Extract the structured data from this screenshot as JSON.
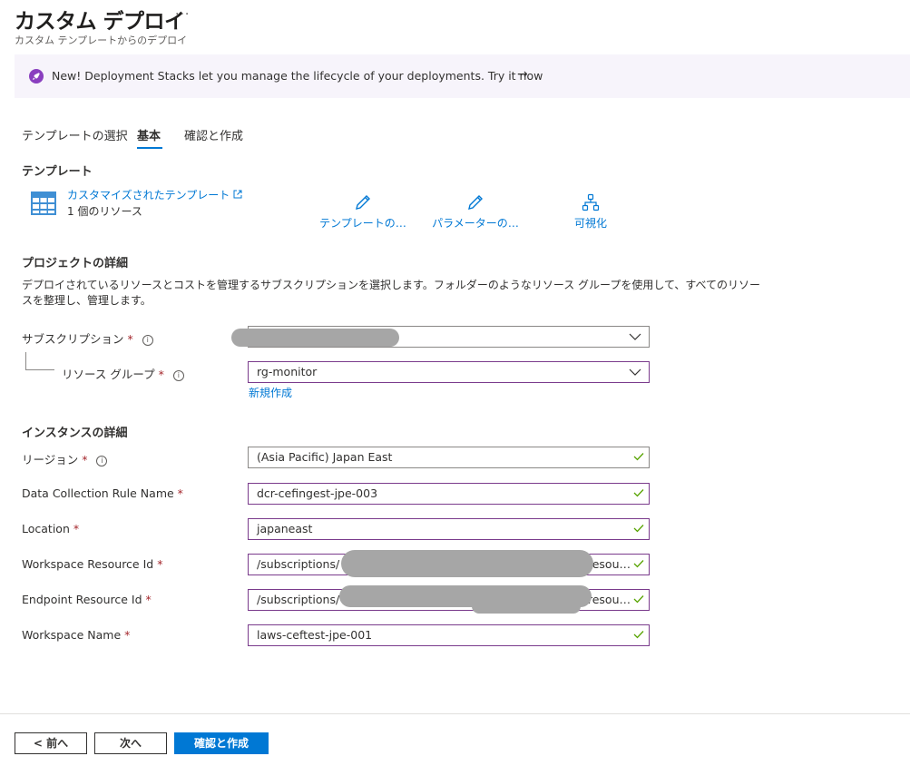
{
  "header": {
    "title": "カスタム デプロイ",
    "more": "···",
    "subtitle": "カスタム テンプレートからのデプロイ"
  },
  "banner": {
    "text": "New! Deployment Stacks let you manage the lifecycle of your deployments. Try it now",
    "arrow": "→",
    "icon": "rocket-icon",
    "accent": "#8a3fbf"
  },
  "tabs": [
    {
      "label": "テンプレートの選択",
      "active": false
    },
    {
      "label": "基本",
      "active": true
    },
    {
      "label": "確認と作成",
      "active": false
    }
  ],
  "template": {
    "heading": "テンプレート",
    "name": "カスタマイズされたテンプレート",
    "resources": "1 個のリソース",
    "actions": [
      {
        "label": "テンプレートの…",
        "icon": "pencil-icon"
      },
      {
        "label": "パラメーターの…",
        "icon": "pencil-icon"
      },
      {
        "label": "可視化",
        "icon": "hierarchy-icon"
      }
    ]
  },
  "project": {
    "heading": "プロジェクトの詳細",
    "description_line1": "デプロイされているリソースとコストを管理するサブスクリプションを選択します。フォルダーのようなリソース グループを使用して、すべてのリソー",
    "description_line2": "スを整理し、管理します。",
    "subscription_label": "サブスクリプション",
    "subscription_value": "",
    "resource_group_label": "リソース グループ",
    "resource_group_value": "rg-monitor",
    "create_new": "新規作成"
  },
  "instance": {
    "heading": "インスタンスの詳細",
    "fields": [
      {
        "label": "リージョン",
        "value": "(Asia Pacific) Japan East",
        "info": true
      },
      {
        "label": "Data Collection Rule Name",
        "value": "dcr-cefingest-jpe-003"
      },
      {
        "label": "Location",
        "value": "japaneast"
      },
      {
        "label": "Workspace Resource Id",
        "value": "/subscriptions/",
        "trail": "resou…"
      },
      {
        "label": "Endpoint Resource Id",
        "value": "/subscriptions/",
        "trail": "resou…"
      },
      {
        "label": "Workspace Name",
        "value": "laws-ceftest-jpe-001"
      }
    ]
  },
  "footer": {
    "prev": "< 前へ",
    "next": "次へ",
    "review": "確認と作成"
  },
  "colors": {
    "accent": "#0078d4",
    "required": "#a4262c",
    "valid": "#57a300",
    "field_border": "#7a3b8c"
  }
}
